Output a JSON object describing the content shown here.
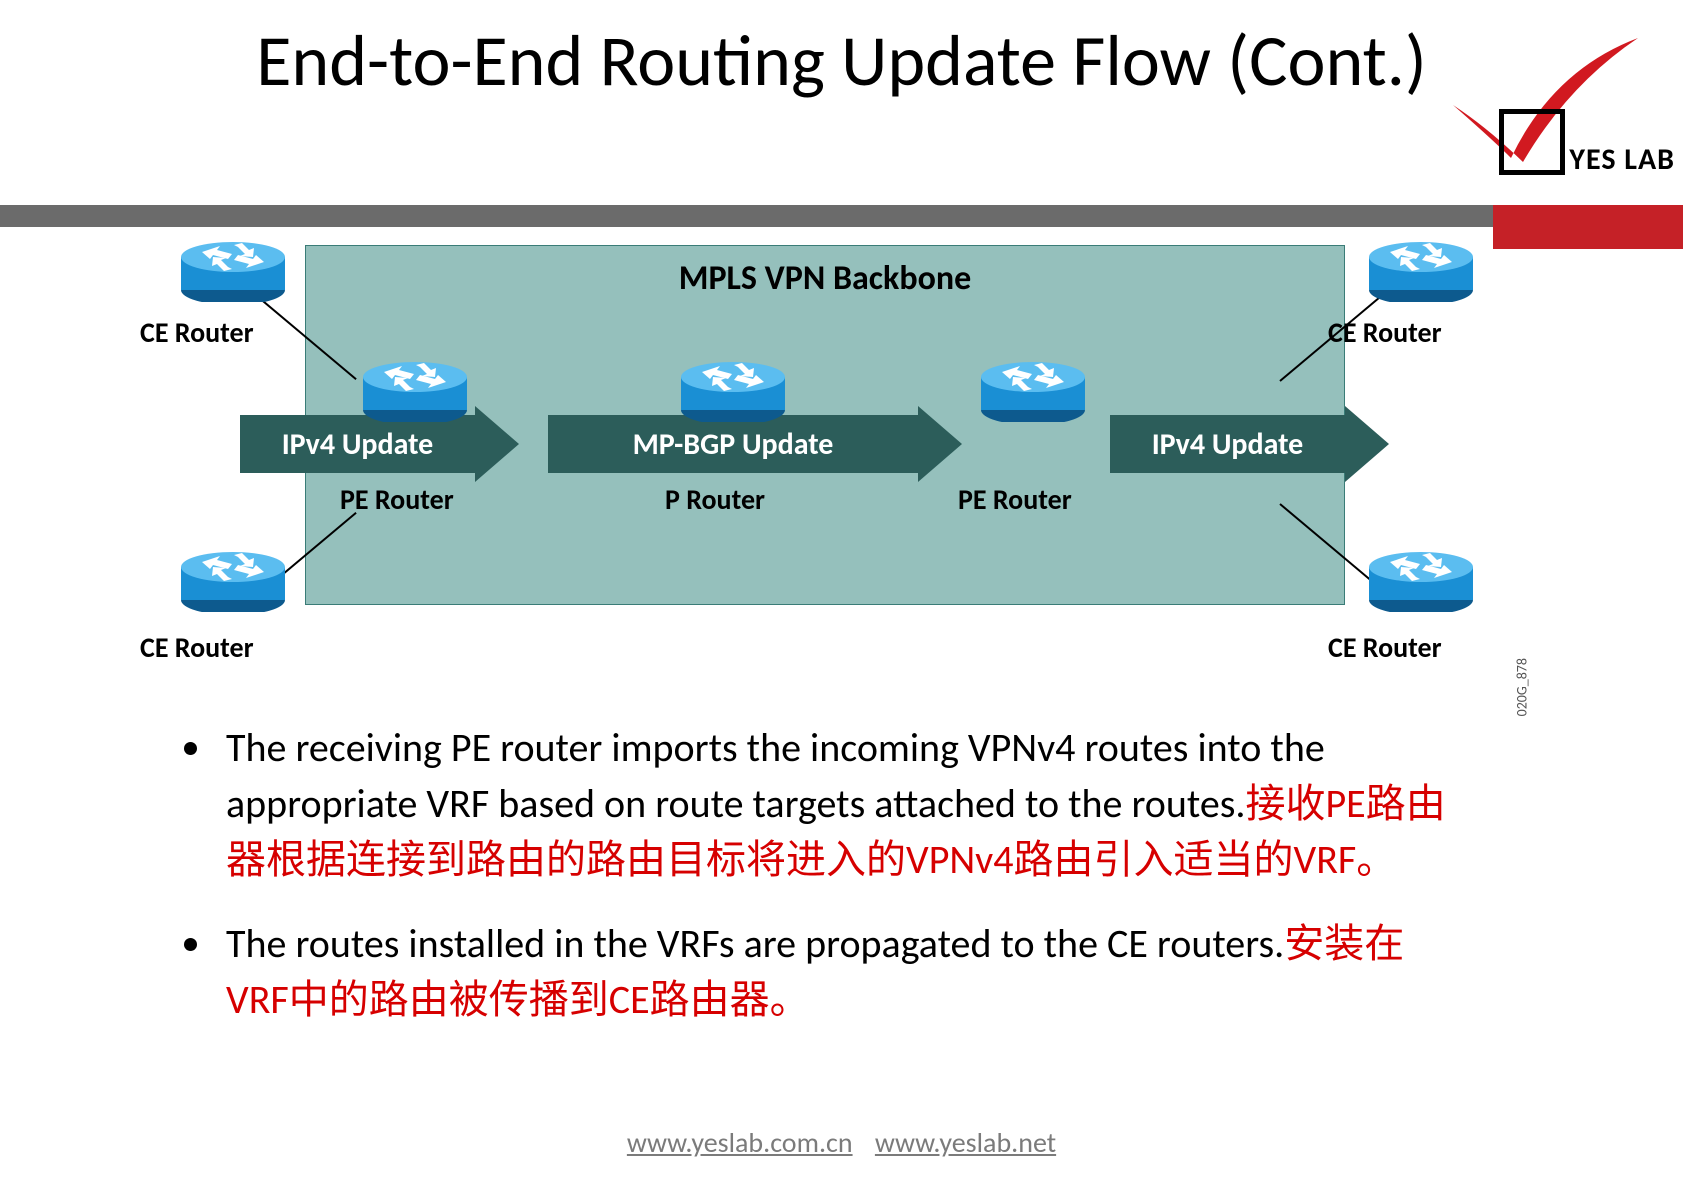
{
  "title": "End-to-End Routing Update Flow (Cont.)",
  "logo_text": "YES LAB",
  "diagram": {
    "backbone_title": "MPLS VPN Backbone",
    "ce_label": "CE Router",
    "pe_label": "PE Router",
    "p_label": "P Router",
    "ipv4_update": "IPv4 Update",
    "mpbgp_update": "MP-BGP Update",
    "code": "020G_878"
  },
  "bullets": [
    {
      "en": "The receiving PE router imports the incoming VPNv4 routes into the appropriate VRF based on route targets attached to the routes.",
      "zh": "接收PE路由器根据连接到路由的路由目标将进入的VPNv4路由引入适当的VRF。"
    },
    {
      "en": "The routes installed in the VRFs are propagated to the CE routers.",
      "zh": "安装在VRF中的路由被传播到CE路由器。"
    }
  ],
  "footer": {
    "link1": "www.yeslab.com.cn",
    "link2": "www.yeslab.net"
  },
  "colors": {
    "accent_red": "#c52127",
    "bar_gray": "#6b6b6b",
    "backbone_fill": "#95c0bc",
    "arrow_fill": "#2c5d5a",
    "text_red": "#d60000"
  }
}
